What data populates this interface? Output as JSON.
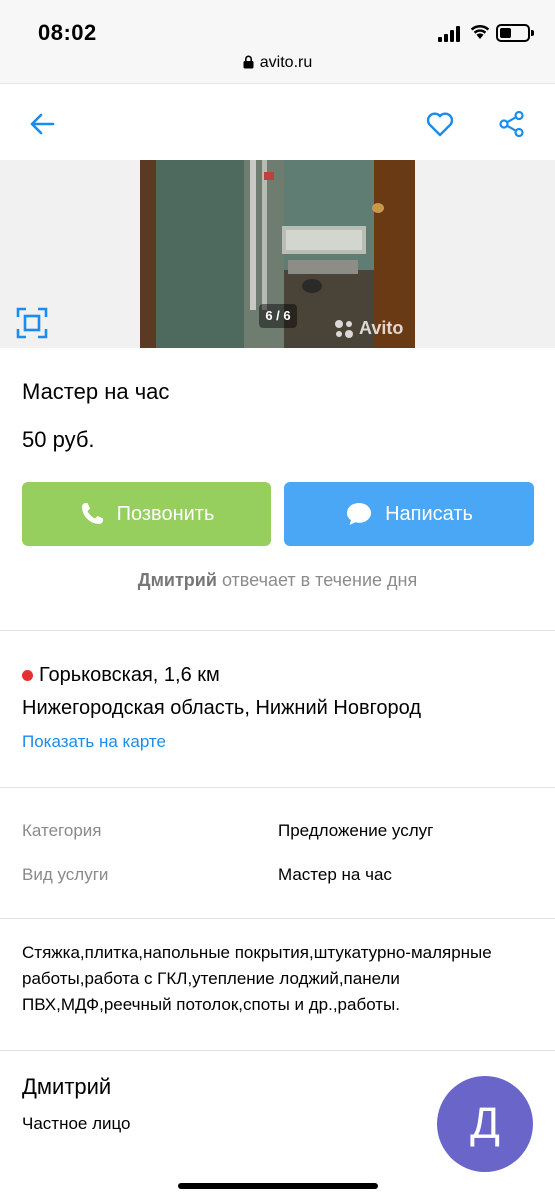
{
  "status": {
    "time": "08:02"
  },
  "browser": {
    "url": "avito.ru"
  },
  "gallery": {
    "counter": "6 / 6",
    "watermark": "Avito"
  },
  "listing": {
    "title": "Мастер на час",
    "price": "50 руб."
  },
  "actions": {
    "call_label": "Позвонить",
    "write_label": "Написать"
  },
  "response": {
    "seller": "Дмитрий",
    "text": "отвечает в течение дня"
  },
  "location": {
    "metro": "Горьковская, 1,6 км",
    "region": "Нижегородская область, Нижний Новгород",
    "map_link": "Показать на карте"
  },
  "params": [
    {
      "label": "Категория",
      "value": "Предложение услуг"
    },
    {
      "label": "Вид услуги",
      "value": "Мастер на час"
    }
  ],
  "description": "Стяжка,плитка,напольные покрытия,штукатурно-малярные работы,работа с ГКЛ,утепление лоджий,панели ПВХ,МДФ,реечный потолок,споты и др.,работы.",
  "seller": {
    "name": "Дмитрий",
    "type": "Частное лицо",
    "avatar_letter": "Д"
  },
  "colors": {
    "call": "#97cf5f",
    "write": "#4aa7f5",
    "link": "#1a8cec",
    "metro": "#e63131",
    "avatar": "#6a66c9"
  }
}
